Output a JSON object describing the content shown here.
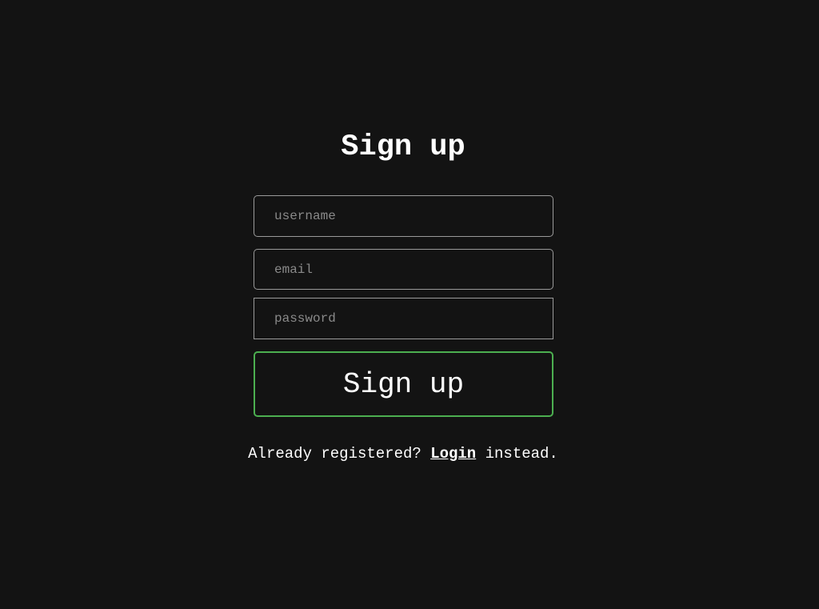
{
  "page": {
    "title": "Sign up",
    "background_color": "#131313",
    "accent_color": "#4caf50"
  },
  "form": {
    "username": {
      "placeholder": "username",
      "value": ""
    },
    "email": {
      "placeholder": "email",
      "value": ""
    },
    "password": {
      "placeholder": "password",
      "value": ""
    },
    "submit_label": "Sign up"
  },
  "footer": {
    "prefix": "Already registered? ",
    "link_label": "Login",
    "suffix": " instead."
  }
}
